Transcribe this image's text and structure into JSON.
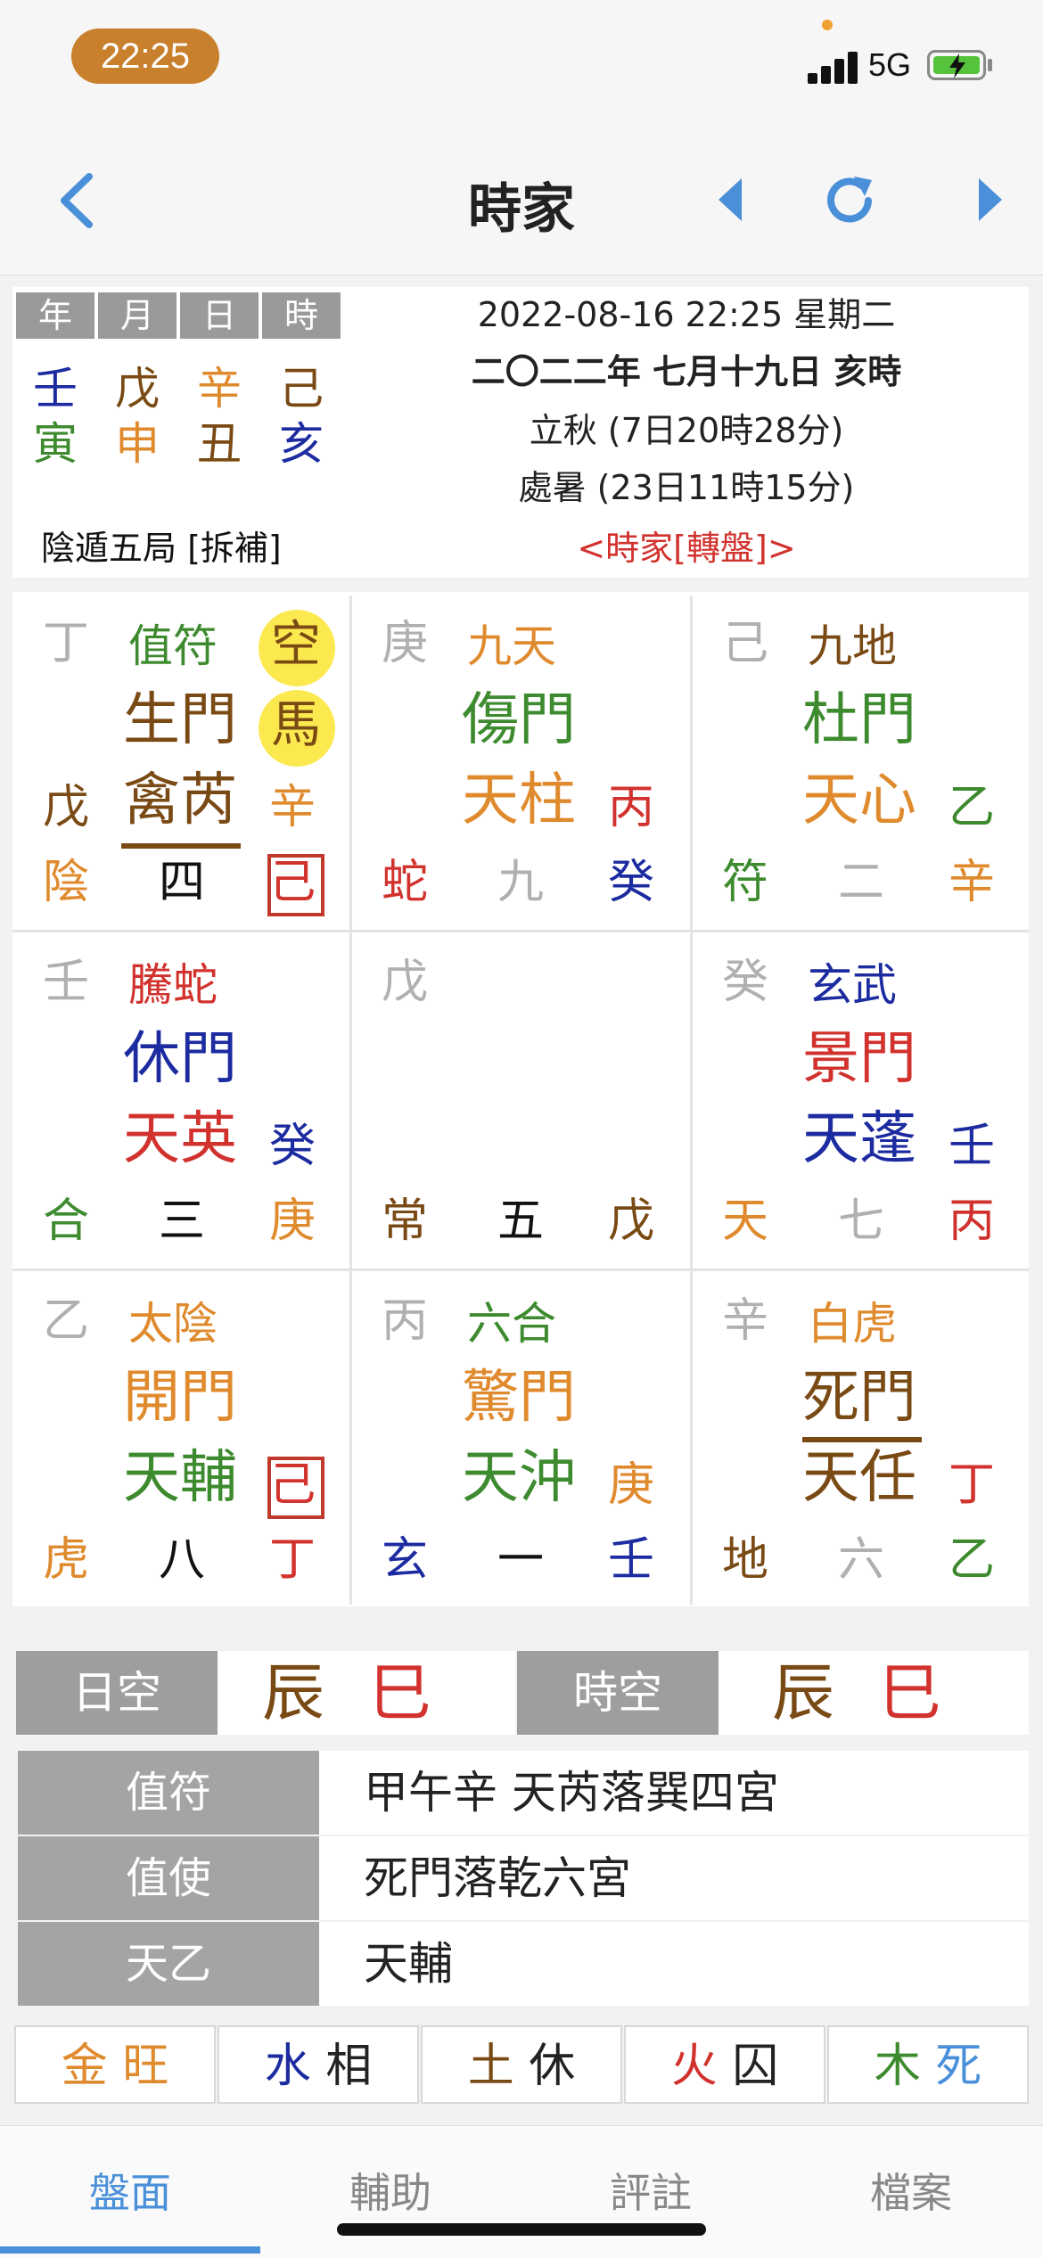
{
  "status": {
    "time": "22:25",
    "network": "5G"
  },
  "nav": {
    "title": "時家",
    "back_icon": "chevron-left-icon",
    "prev_icon": "triangle-left-icon",
    "refresh_icon": "refresh-icon",
    "next_icon": "triangle-right-icon"
  },
  "pillars": {
    "headers": [
      "年",
      "月",
      "日",
      "時"
    ],
    "stems": [
      "壬",
      "戊",
      "辛",
      "己"
    ],
    "branches": [
      "寅",
      "申",
      "丑",
      "亥"
    ],
    "bureau": "陰遁五局 [拆補]"
  },
  "info": {
    "datetime": "2022-08-16 22:25 星期二",
    "lunar": "二〇二二年 七月十九日 亥時",
    "term1": "立秋 (7日20時28分)",
    "term2": "處暑 (23日11時15分)",
    "mode_link": "<時家[轉盤]>"
  },
  "palaces": [
    {
      "earth_left": "丁",
      "deity": "值符",
      "door": "生門",
      "star": "禽芮",
      "heaven_stem": "辛",
      "side_stem": "戊",
      "spirit": "陰",
      "number": "四",
      "corner": "己",
      "badges": [
        "空",
        "馬"
      ]
    },
    {
      "earth_left": "庚",
      "deity": "九天",
      "door": "傷門",
      "star": "天柱",
      "heaven_stem": "丙",
      "spirit": "蛇",
      "number": "九",
      "corner": "癸"
    },
    {
      "earth_left": "己",
      "deity": "九地",
      "door": "杜門",
      "star": "天心",
      "heaven_stem": "乙",
      "spirit": "符",
      "number": "二",
      "corner": "辛"
    },
    {
      "earth_left": "壬",
      "deity": "騰蛇",
      "door": "休門",
      "star": "天英",
      "heaven_stem": "癸",
      "spirit": "合",
      "number": "三",
      "corner": "庚"
    },
    {
      "earth_left": "戊",
      "spirit": "常",
      "number": "五",
      "corner": "戊"
    },
    {
      "earth_left": "癸",
      "deity": "玄武",
      "door": "景門",
      "star": "天蓬",
      "heaven_stem": "壬",
      "spirit": "天",
      "number": "七",
      "corner": "丙"
    },
    {
      "earth_left": "乙",
      "deity": "太陰",
      "door": "開門",
      "star": "天輔",
      "heaven_stem": "己",
      "spirit": "虎",
      "number": "八",
      "corner": "丁"
    },
    {
      "earth_left": "丙",
      "deity": "六合",
      "door": "驚門",
      "star": "天沖",
      "heaven_stem": "庚",
      "spirit": "玄",
      "number": "一",
      "corner": "壬"
    },
    {
      "earth_left": "辛",
      "deity": "白虎",
      "door": "死門",
      "star": "天任",
      "heaven_stem": "丁",
      "spirit": "地",
      "number": "六",
      "corner": "乙"
    }
  ],
  "kong": {
    "day_label": "日空",
    "day_values": [
      "辰",
      "巳"
    ],
    "hour_label": "時空",
    "hour_values": [
      "辰",
      "巳"
    ]
  },
  "table": [
    {
      "label": "值符",
      "value": "甲午辛  天芮落巽四宮"
    },
    {
      "label": "值使",
      "value": "死門落乾六宮"
    },
    {
      "label": "天乙",
      "value": "天輔"
    }
  ],
  "elements": [
    {
      "element": "金",
      "state": "旺"
    },
    {
      "element": "水",
      "state": "相"
    },
    {
      "element": "土",
      "state": "休"
    },
    {
      "element": "火",
      "state": "囚"
    },
    {
      "element": "木",
      "state": "死"
    }
  ],
  "tabs": [
    "盤面",
    "輔助",
    "評註",
    "檔案"
  ],
  "colors": {
    "accent": "#4a90d9",
    "red": "#d2322d",
    "orange": "#e08a2e",
    "green": "#3e8b2f",
    "blue": "#1c2ba0",
    "brown": "#7a4a15",
    "gray": "#b0b0b0"
  }
}
